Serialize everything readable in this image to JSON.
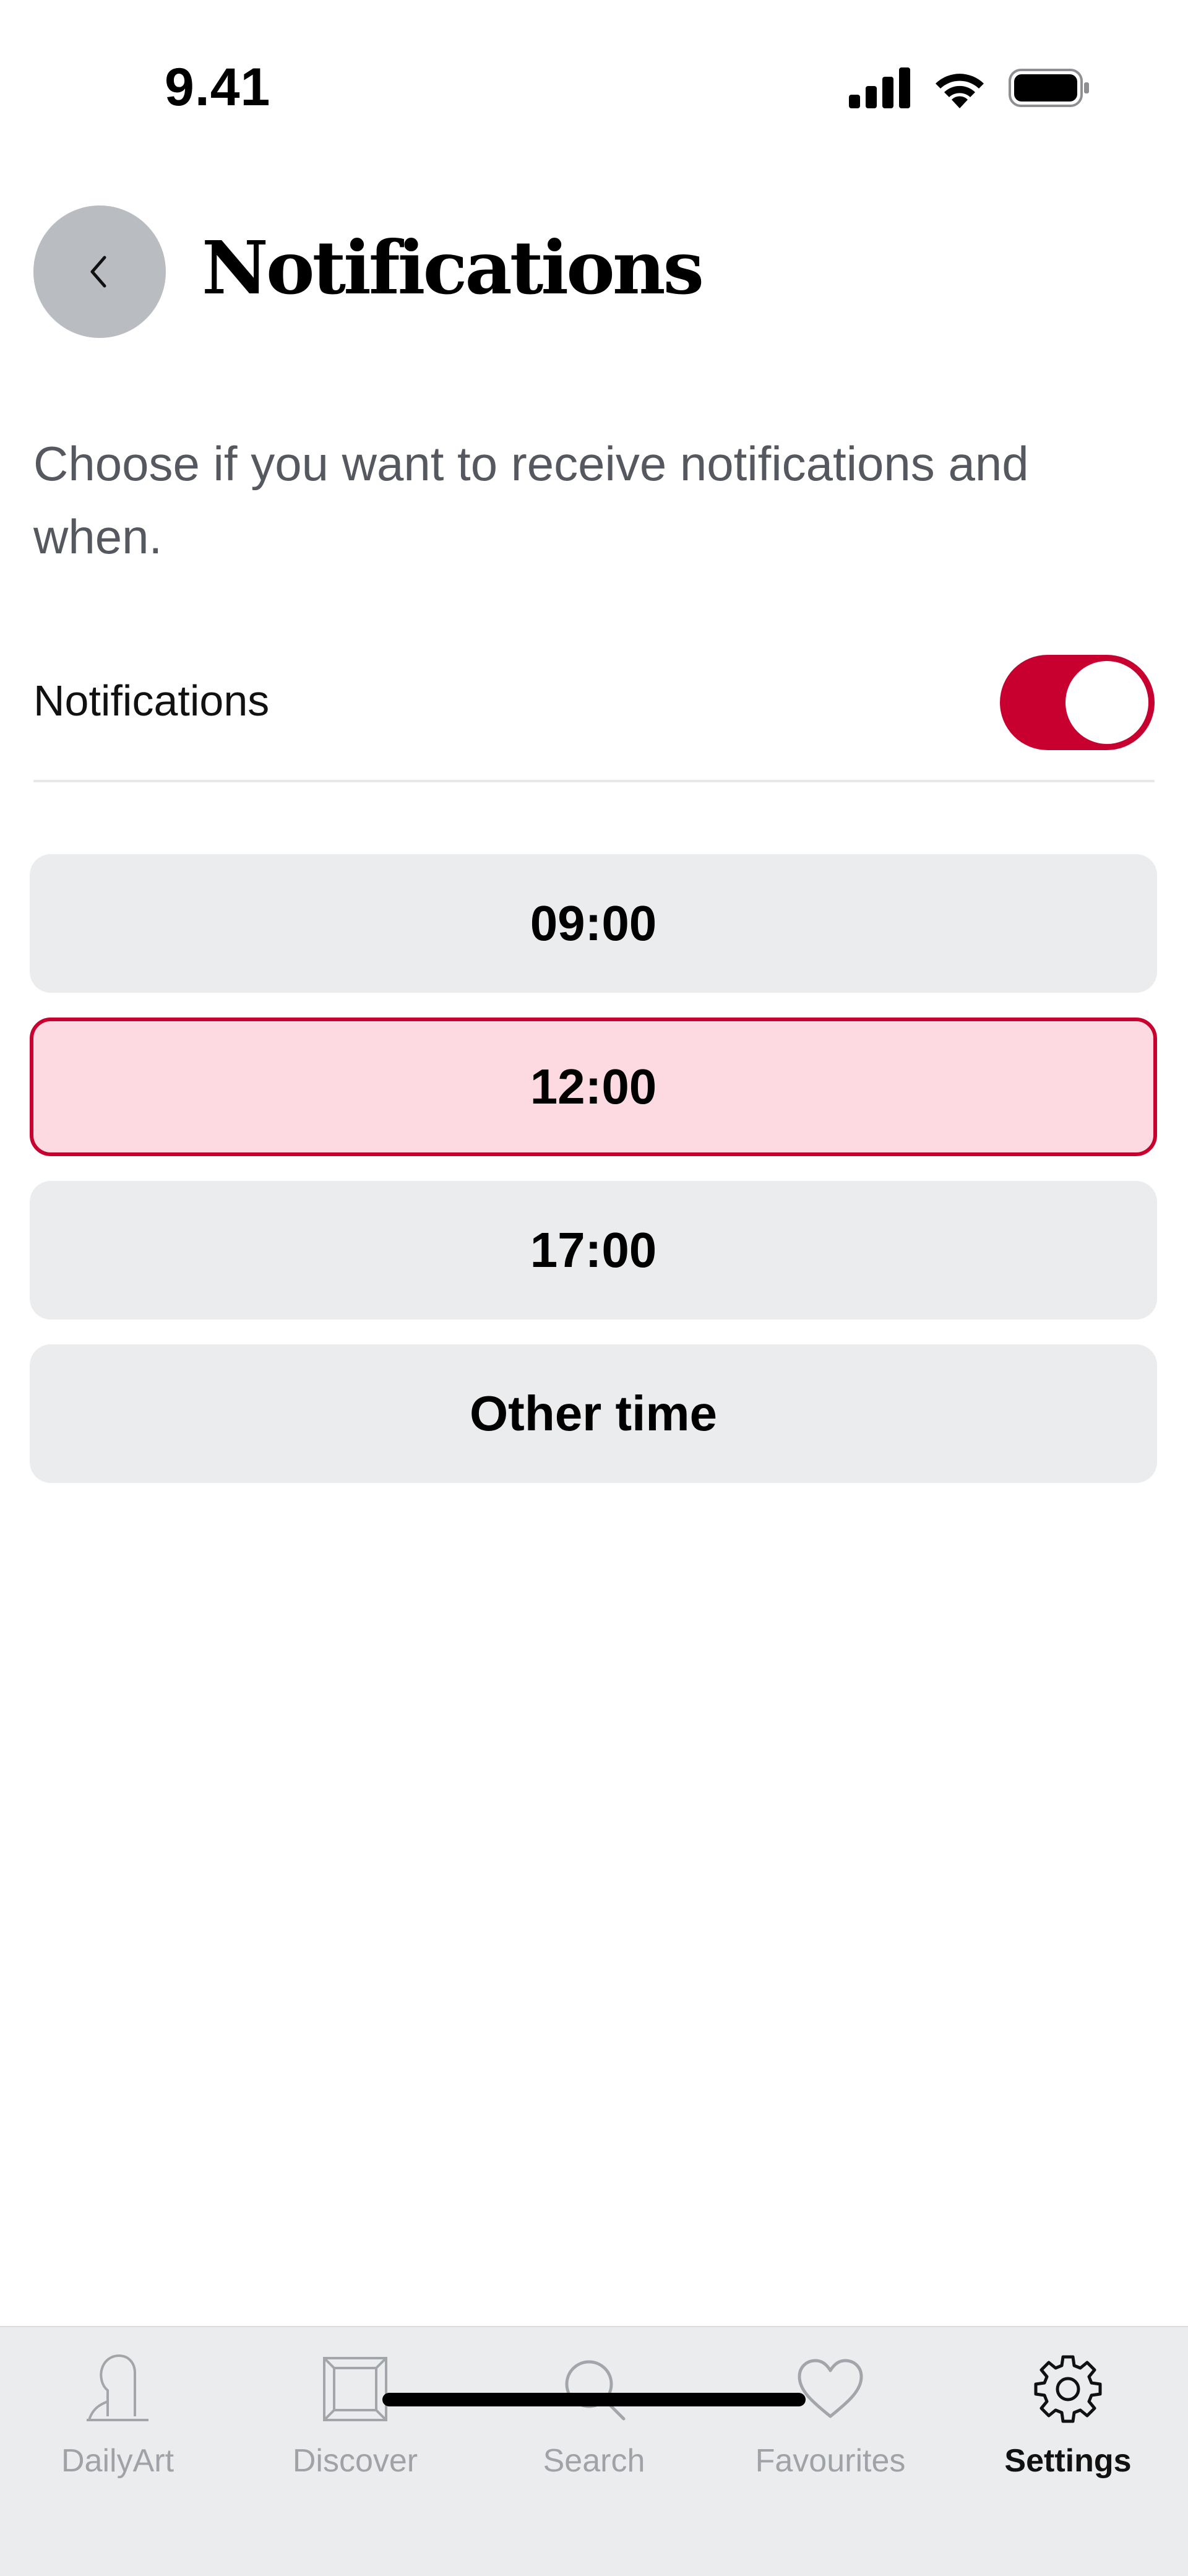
{
  "status_bar": {
    "time": "9.41",
    "icons": [
      "cellular-signal-icon",
      "wifi-icon",
      "battery-icon"
    ]
  },
  "header": {
    "back_icon": "chevron-left-icon",
    "title": "Notifications"
  },
  "description": "Choose if you want to receive notifications and when.",
  "notifications_toggle": {
    "label": "Notifications",
    "enabled": true
  },
  "time_options": [
    {
      "label": "09:00",
      "selected": false
    },
    {
      "label": "12:00",
      "selected": true
    },
    {
      "label": "17:00",
      "selected": false
    },
    {
      "label": "Other time",
      "selected": false
    }
  ],
  "tab_bar": {
    "tabs": [
      {
        "label": "DailyArt",
        "icon": "portrait-icon",
        "active": false
      },
      {
        "label": "Discover",
        "icon": "frame-icon",
        "active": false
      },
      {
        "label": "Search",
        "icon": "search-icon",
        "active": false
      },
      {
        "label": "Favourites",
        "icon": "heart-icon",
        "active": false
      },
      {
        "label": "Settings",
        "icon": "gear-icon",
        "active": true
      }
    ]
  },
  "colors": {
    "accent": "#c8002f",
    "selected_background": "#fdd9e2",
    "option_background": "#ebecee",
    "back_button": "#b9bcc1"
  }
}
